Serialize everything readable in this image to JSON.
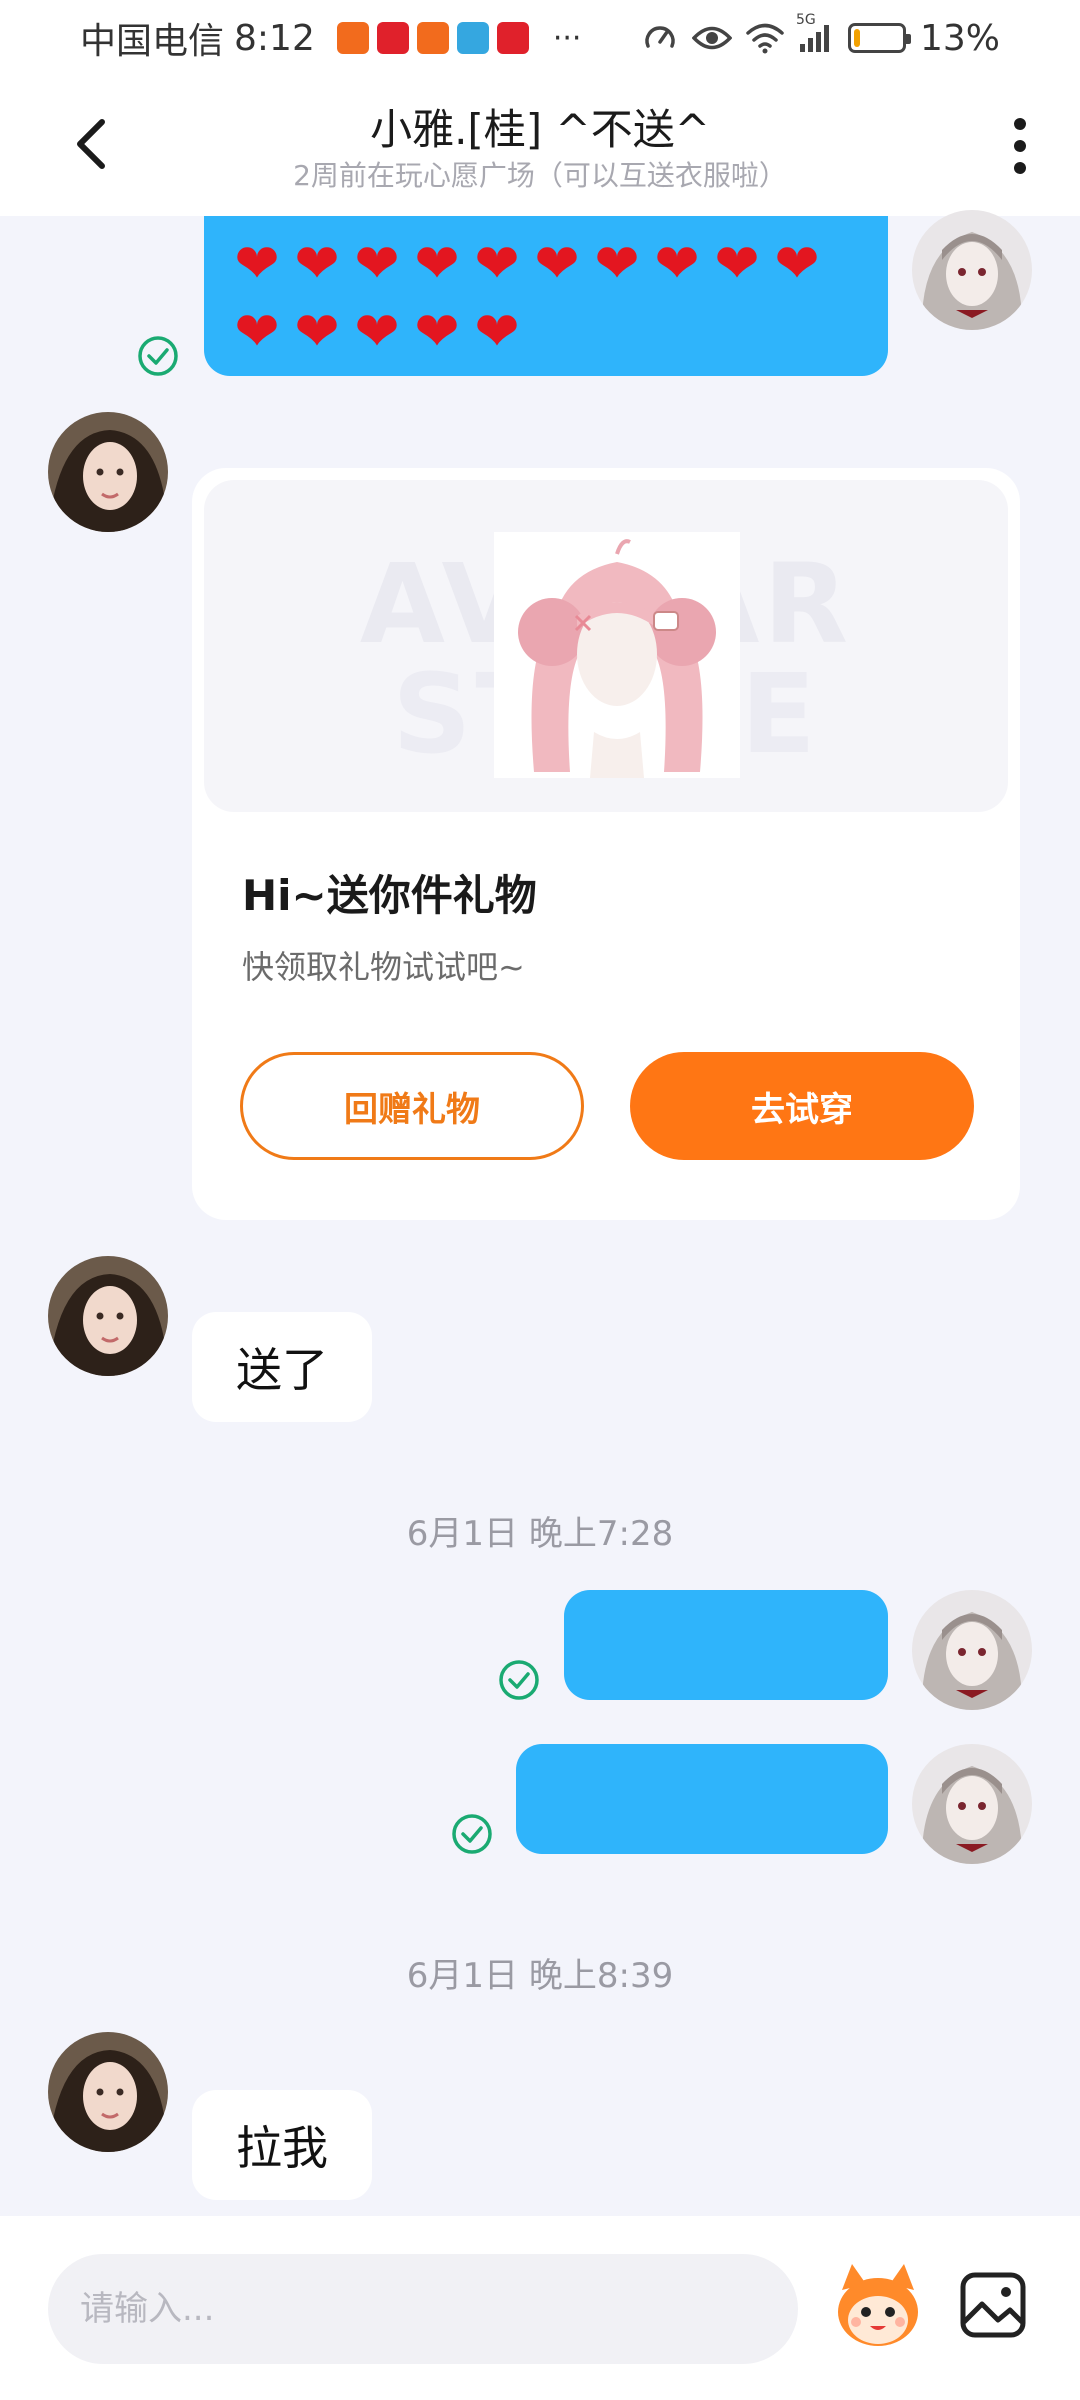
{
  "status_bar": {
    "carrier": "中国电信",
    "time": "8:12",
    "more": "···",
    "network": "5G",
    "battery": "13%",
    "battery_level": 0.13
  },
  "header": {
    "title": "小雅.[桂] ^不送^",
    "subtitle": "2周前在玩心愿广场（可以互送衣服啦）"
  },
  "messages": {
    "hearts_row1": [
      "❤",
      "❤",
      "❤",
      "❤",
      "❤",
      "❤",
      "❤",
      "❤",
      "❤",
      "❤"
    ],
    "hearts_row2": [
      "❤",
      "❤",
      "❤",
      "❤",
      "❤"
    ],
    "gift_card": {
      "watermark_top": "AVATAR",
      "watermark_bottom": "STORE",
      "title": "Hi~送你件礼物",
      "description": "快领取礼物试试吧~",
      "return_gift_label": "回赠礼物",
      "try_on_label": "去试穿"
    },
    "reply_1": "送了",
    "timestamp_1": "6月1日 晚上7:28",
    "timestamp_2": "6月1日 晚上8:39",
    "reply_2": "拉我"
  },
  "input": {
    "placeholder": "请输入..."
  },
  "colors": {
    "outgoing_bubble": "#2fb4fb",
    "accent_orange": "#ff7614",
    "read_check": "#1aaa72",
    "heart": "#e31620"
  }
}
